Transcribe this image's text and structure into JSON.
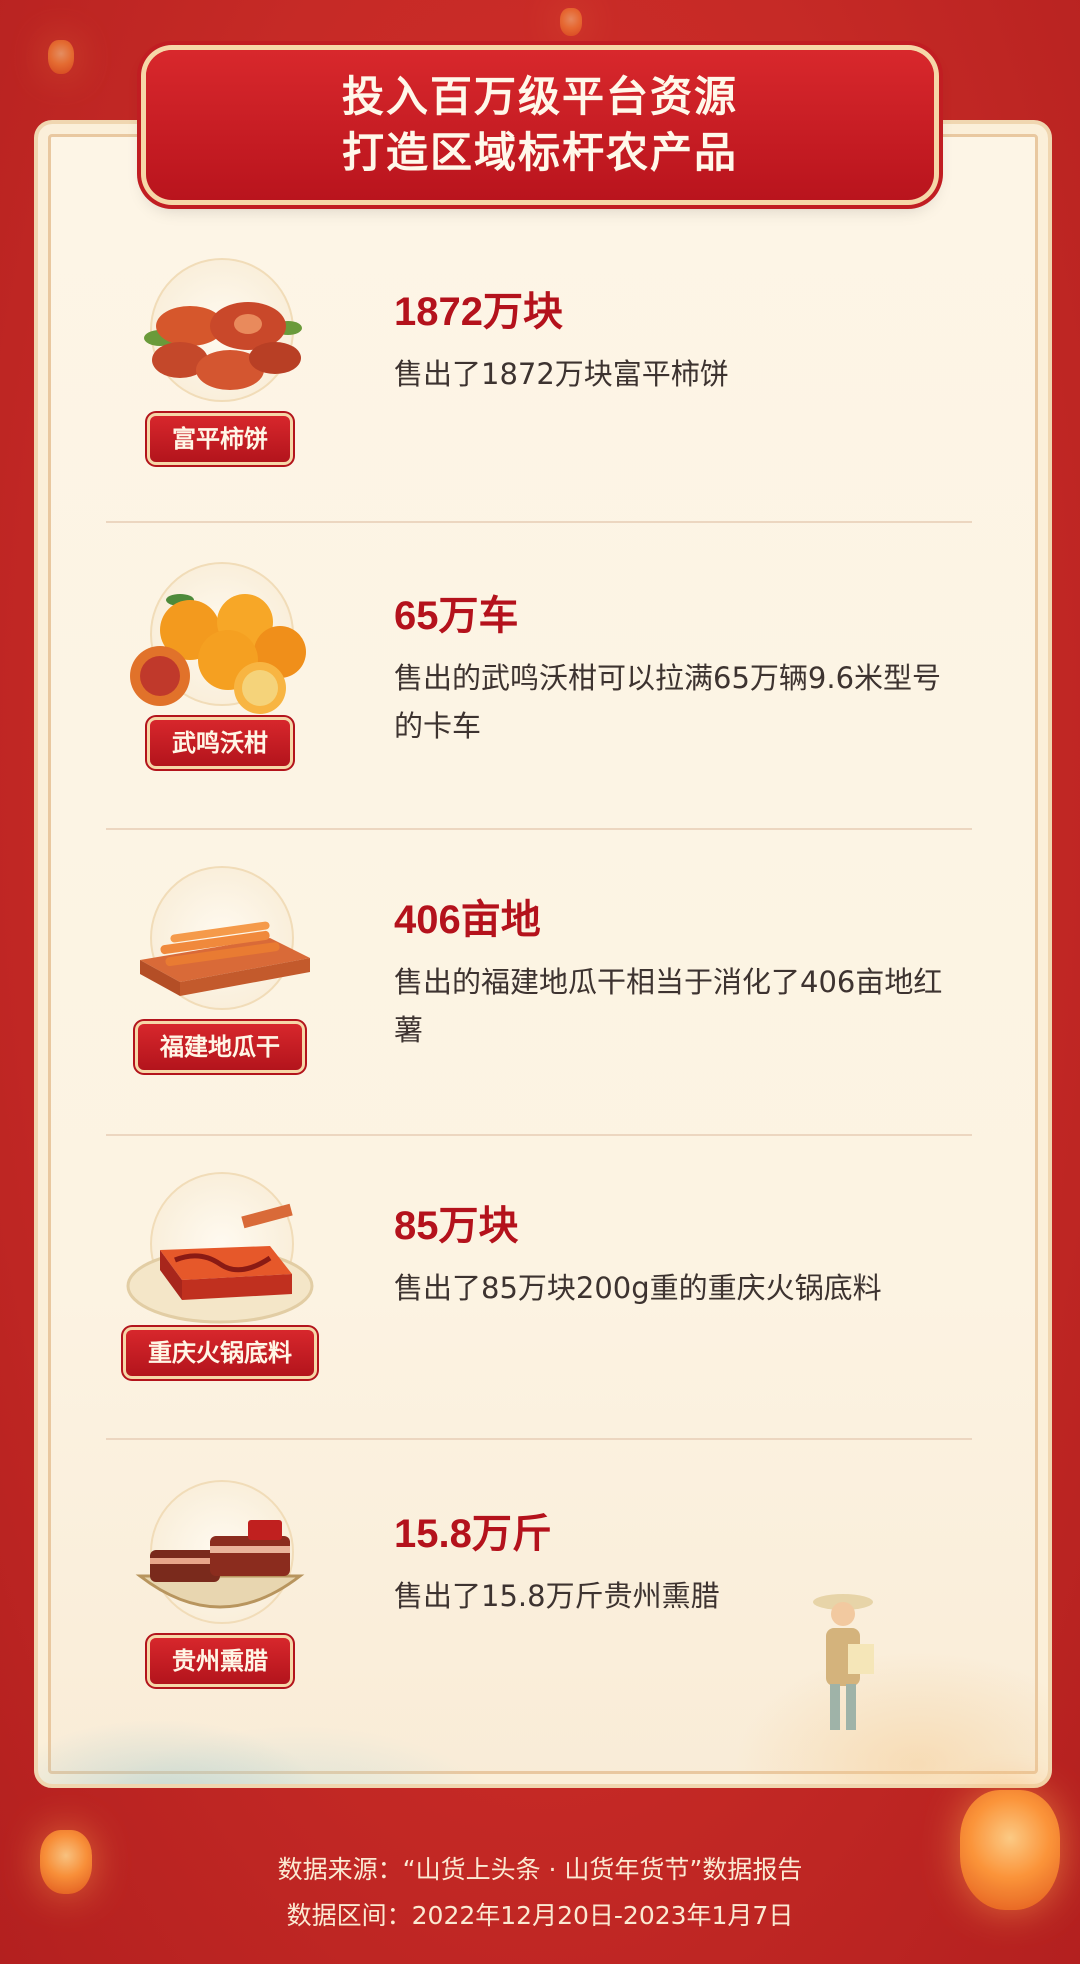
{
  "header": {
    "title_line1": "投入百万级平台资源",
    "title_line2": "打造区域标杆农产品"
  },
  "items": [
    {
      "tag": "富平柿饼",
      "value": "1872万块",
      "desc": "售出了1872万块富平柿饼"
    },
    {
      "tag": "武鸣沃柑",
      "value": "65万车",
      "desc": "售出的武鸣沃柑可以拉满65万辆9.6米型号的卡车"
    },
    {
      "tag": "福建地瓜干",
      "value": "406亩地",
      "desc": "售出的福建地瓜干相当于消化了406亩地红薯"
    },
    {
      "tag": "重庆火锅底料",
      "value": "85万块",
      "desc": "售出了85万块200g重的重庆火锅底料"
    },
    {
      "tag": "贵州熏腊",
      "value": "15.8万斤",
      "desc": "售出了15.8万斤贵州熏腊"
    }
  ],
  "footer": {
    "source": "数据来源：“山货上头条 · 山货年货节”数据报告",
    "range": "数据区间：2022年12月20日-2023年1月7日"
  },
  "colors": {
    "background": "#c62a26",
    "accent_red": "#b4121c",
    "card": "#fdf5e6"
  }
}
